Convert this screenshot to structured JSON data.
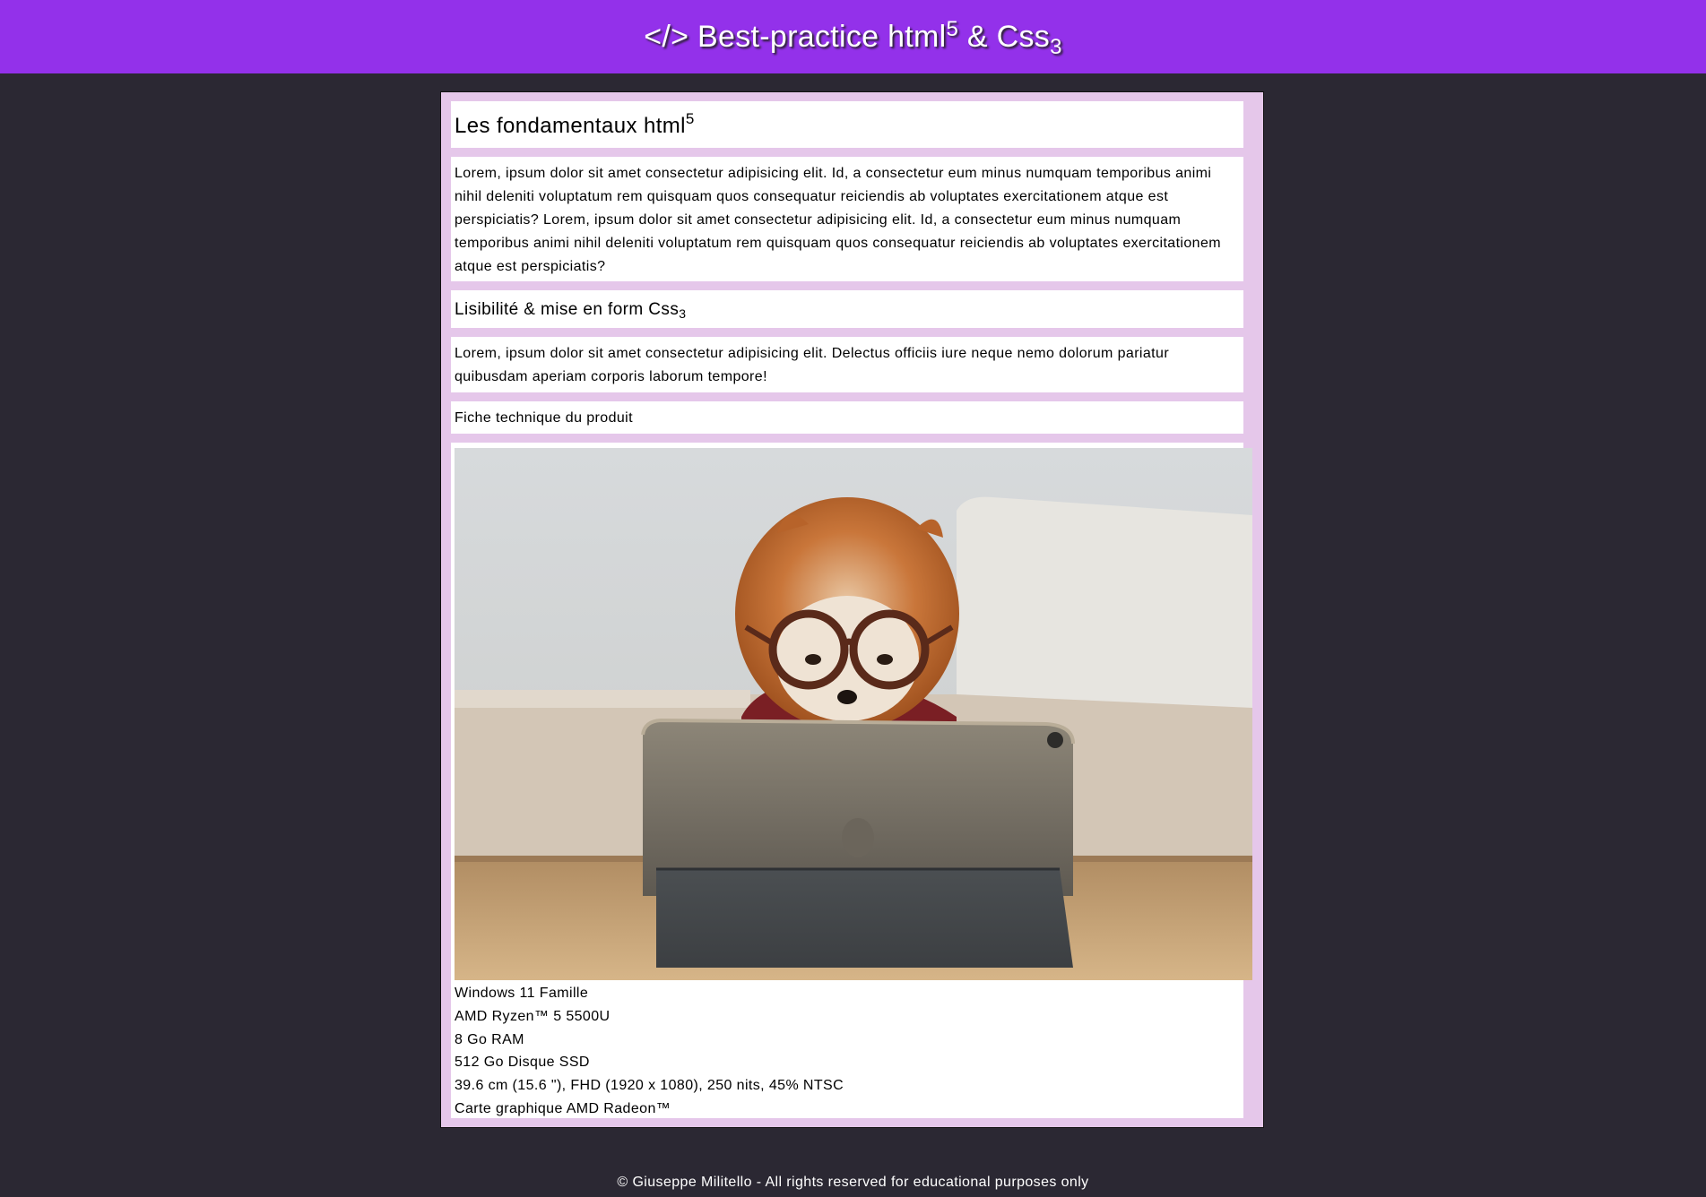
{
  "header": {
    "title_prefix": "</> Best-practice html",
    "title_sup": "5",
    "title_mid": " & Css",
    "title_sub": "3"
  },
  "section1": {
    "heading": "Les fondamentaux html",
    "heading_sup": "5",
    "text": "Lorem, ipsum dolor sit amet consectetur adipisicing elit. Id, a consectetur eum minus numquam temporibus animi nihil deleniti voluptatum rem quisquam quos consequatur reiciendis ab voluptates exercitationem atque est perspiciatis? Lorem, ipsum dolor sit amet consectetur adipisicing elit. Id, a consectetur eum minus numquam temporibus animi nihil deleniti voluptatum rem quisquam quos consequatur reiciendis ab voluptates exercitationem atque est perspiciatis?"
  },
  "section2": {
    "heading": "Lisibilité & mise en form Css",
    "heading_sub": "3",
    "text": "Lorem, ipsum dolor sit amet consectetur adipisicing elit. Delectus officiis iure neque nemo dolorum pariatur quibusdam aperiam corporis laborum tempore!"
  },
  "product": {
    "fiche_label": "Fiche technique du produit",
    "specs": [
      "Windows 11 Famille",
      "AMD Ryzen™ 5 5500U",
      "8 Go RAM",
      "512 Go Disque SSD",
      "39.6 cm (15.6 \"), FHD (1920 x 1080), 250 nits, 45% NTSC",
      "Carte graphique AMD Radeon™"
    ]
  },
  "footer": {
    "text": "© Giuseppe Militello - All rights reserved for educational purposes only"
  },
  "colors": {
    "header_bg": "#9331ea",
    "page_bg": "#2b2833",
    "panel_bg": "#e5c7ea",
    "block_bg": "#ffffff"
  }
}
